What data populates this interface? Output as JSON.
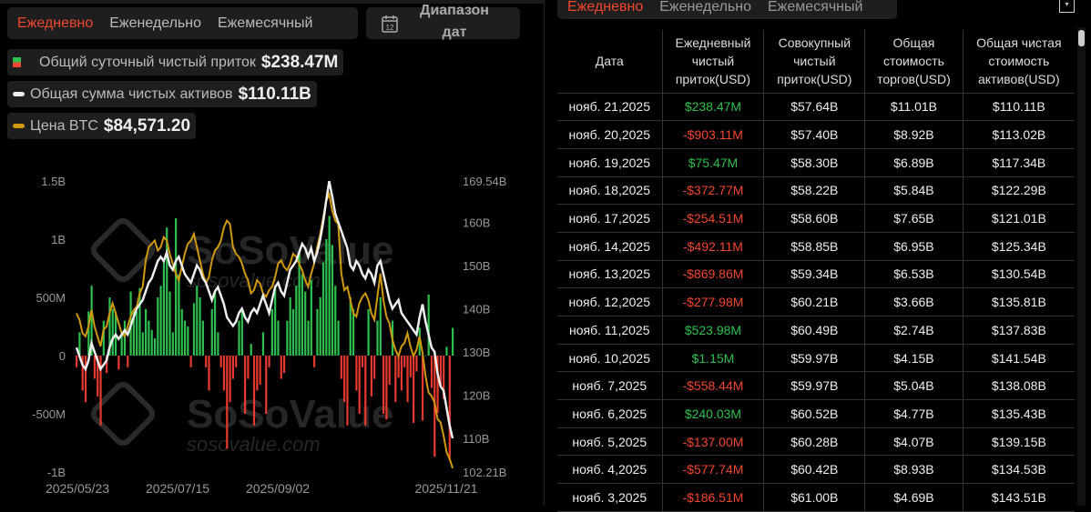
{
  "left": {
    "tabs": [
      "Ежедневно",
      "Еженедельно",
      "Ежемесячный"
    ],
    "date_range_label": "Диапазон дат",
    "calendar_day": "12",
    "legend": [
      {
        "label": "Общий суточный чистый приток",
        "value": "$238.47M"
      },
      {
        "label": "Общая сумма чистых активов",
        "value": "$110.11B"
      },
      {
        "label": "Цена BTC",
        "value": "$84,571.20"
      }
    ],
    "watermark": "SoSoValue",
    "watermark_url": "sosovalue.com"
  },
  "colors": {
    "accent": "#f2462e",
    "positive": "#2ec04f",
    "negative": "#e8392e",
    "assets": "#eeeeee",
    "btc": "#d19a0e"
  },
  "chart_data": {
    "type": "bar",
    "left_ticks": [
      "1.5B",
      "1B",
      "500M",
      "0",
      "-500M",
      "-1B"
    ],
    "left_values": [
      1500,
      1000,
      500,
      0,
      -500,
      -1000
    ],
    "right_ticks": [
      "169.54B",
      "160B",
      "150B",
      "140B",
      "130B",
      "120B",
      "110B",
      "102.21B"
    ],
    "right_values": [
      169.54,
      160,
      150,
      140,
      130,
      120,
      110,
      102.21
    ],
    "x_ticks": [
      "2025/05/23",
      "2025/07/15",
      "2025/09/02",
      "2025/11/21"
    ],
    "ylim_left": [
      -1000,
      1500
    ],
    "ylim_right": [
      102.21,
      169.54
    ],
    "ylim_price": [
      84000,
      128000
    ],
    "daily_inflow_musd": [
      -100,
      200,
      -300,
      -400,
      380,
      600,
      -200,
      -350,
      -600,
      300,
      -150,
      500,
      400,
      380,
      -120,
      200,
      300,
      -100,
      550,
      400,
      380,
      580,
      200,
      400,
      300,
      220,
      150,
      500,
      600,
      800,
      1100,
      550,
      200,
      1180,
      700,
      400,
      300,
      250,
      -100,
      450,
      600,
      500,
      300,
      -100,
      -300,
      400,
      550,
      200,
      -100,
      -300,
      -800,
      -400,
      -200,
      -100,
      300,
      400,
      -500,
      -200,
      100,
      -600,
      -300,
      -250,
      200,
      -500,
      -100,
      400,
      600,
      300,
      -200,
      -150,
      300,
      500,
      400,
      600,
      900,
      700,
      550,
      300,
      650,
      -100,
      400,
      500,
      800,
      1000,
      1200,
      950,
      600,
      300,
      -200,
      -400,
      -600,
      500,
      400,
      -300,
      -500,
      -100,
      -600,
      400,
      -350,
      -200,
      300,
      500,
      -500,
      -550,
      -250,
      300,
      -400,
      -190,
      -300,
      -100,
      -400,
      -187,
      -578,
      -137,
      240,
      -558,
      1.15,
      524,
      -278,
      -870,
      -492,
      -255,
      -373,
      75,
      -903,
      238
    ],
    "total_assets_busd": [
      131,
      129,
      127,
      126,
      128,
      132,
      130,
      128,
      126,
      127,
      128,
      131,
      133,
      134,
      133,
      134,
      135,
      134,
      136,
      138,
      140,
      141,
      142,
      144,
      146,
      147,
      149,
      151,
      152,
      151,
      153,
      150,
      149,
      151,
      152,
      150,
      148,
      147,
      146,
      148,
      150,
      149,
      147,
      146,
      144,
      142,
      144,
      145,
      143,
      141,
      138,
      137,
      136,
      137,
      139,
      140,
      138,
      137,
      139,
      140,
      139,
      141,
      143,
      141,
      139,
      142,
      145,
      146,
      144,
      143,
      146,
      149,
      150,
      151,
      153,
      155,
      154,
      152,
      154,
      151,
      153,
      156,
      160,
      165,
      169.5,
      166,
      162,
      160,
      158,
      156,
      154,
      150,
      149,
      151,
      150,
      148,
      147,
      149,
      148,
      146,
      150,
      151,
      148,
      145,
      142,
      140,
      141,
      142,
      139,
      138,
      137,
      136,
      135,
      134,
      138,
      141,
      137,
      134,
      131,
      130,
      125,
      122,
      121,
      117,
      113,
      110
    ],
    "btc_price_usd": [
      108000,
      107000,
      105000,
      104500,
      106000,
      108500,
      106000,
      104500,
      103000,
      105500,
      106000,
      108000,
      109500,
      108000,
      106500,
      105000,
      104500,
      106000,
      107500,
      108500,
      109000,
      111000,
      112000,
      116000,
      118000,
      118500,
      119000,
      117500,
      118000,
      119500,
      119000,
      117000,
      115500,
      114000,
      113000,
      115000,
      117000,
      118500,
      119000,
      120000,
      118000,
      116000,
      114000,
      112500,
      113500,
      116000,
      117500,
      118000,
      119000,
      121000,
      122000,
      121500,
      118000,
      117000,
      116500,
      115500,
      114000,
      113000,
      111000,
      111500,
      113000,
      112500,
      111000,
      110500,
      111500,
      112000,
      113500,
      115500,
      116000,
      115000,
      114500,
      115500,
      117000,
      116500,
      115500,
      114500,
      113000,
      112000,
      114000,
      115500,
      118000,
      120000,
      122500,
      125000,
      126000,
      123500,
      122000,
      121500,
      114000,
      111500,
      112000,
      110000,
      108000,
      107500,
      109500,
      110500,
      111000,
      110000,
      108000,
      107000,
      110500,
      114000,
      110000,
      107500,
      106500,
      104000,
      102500,
      101500,
      103000,
      103500,
      105000,
      103000,
      101500,
      102500,
      104500,
      102000,
      98500,
      96000,
      95500,
      94500,
      92000,
      91500,
      89500,
      87000,
      86000,
      84571
    ]
  },
  "right": {
    "tabs": [
      "Ежедневно",
      "Еженедельно",
      "Ежемесячный"
    ],
    "columns": [
      "Дата",
      "Ежедневный чистый приток(USD)",
      "Совокупный чистый приток(USD)",
      "Общая стоимость торгов(USD)",
      "Общая чистая стоимость активов(USD)"
    ],
    "rows": [
      [
        "нояб. 21,2025",
        "$238.47M",
        "$57.64B",
        "$11.01B",
        "$110.11B"
      ],
      [
        "нояб. 20,2025",
        "-$903.11M",
        "$57.40B",
        "$8.92B",
        "$113.02B"
      ],
      [
        "нояб. 19,2025",
        "$75.47M",
        "$58.30B",
        "$6.89B",
        "$117.34B"
      ],
      [
        "нояб. 18,2025",
        "-$372.77M",
        "$58.22B",
        "$5.84B",
        "$122.29B"
      ],
      [
        "нояб. 17,2025",
        "-$254.51M",
        "$58.60B",
        "$7.65B",
        "$121.01B"
      ],
      [
        "нояб. 14,2025",
        "-$492.11M",
        "$58.85B",
        "$6.95B",
        "$125.34B"
      ],
      [
        "нояб. 13,2025",
        "-$869.86M",
        "$59.34B",
        "$6.53B",
        "$130.54B"
      ],
      [
        "нояб. 12,2025",
        "-$277.98M",
        "$60.21B",
        "$3.66B",
        "$135.81B"
      ],
      [
        "нояб. 11,2025",
        "$523.98M",
        "$60.49B",
        "$2.74B",
        "$137.83B"
      ],
      [
        "нояб. 10,2025",
        "$1.15M",
        "$59.97B",
        "$4.15B",
        "$141.54B"
      ],
      [
        "нояб. 7,2025",
        "-$558.44M",
        "$59.97B",
        "$5.04B",
        "$138.08B"
      ],
      [
        "нояб. 6,2025",
        "$240.03M",
        "$60.52B",
        "$4.77B",
        "$135.43B"
      ],
      [
        "нояб. 5,2025",
        "-$137.00M",
        "$60.28B",
        "$4.07B",
        "$139.15B"
      ],
      [
        "нояб. 4,2025",
        "-$577.74M",
        "$60.42B",
        "$8.93B",
        "$134.53B"
      ],
      [
        "нояб. 3,2025",
        "-$186.51M",
        "$61.00B",
        "$4.69B",
        "$143.51B"
      ]
    ]
  }
}
